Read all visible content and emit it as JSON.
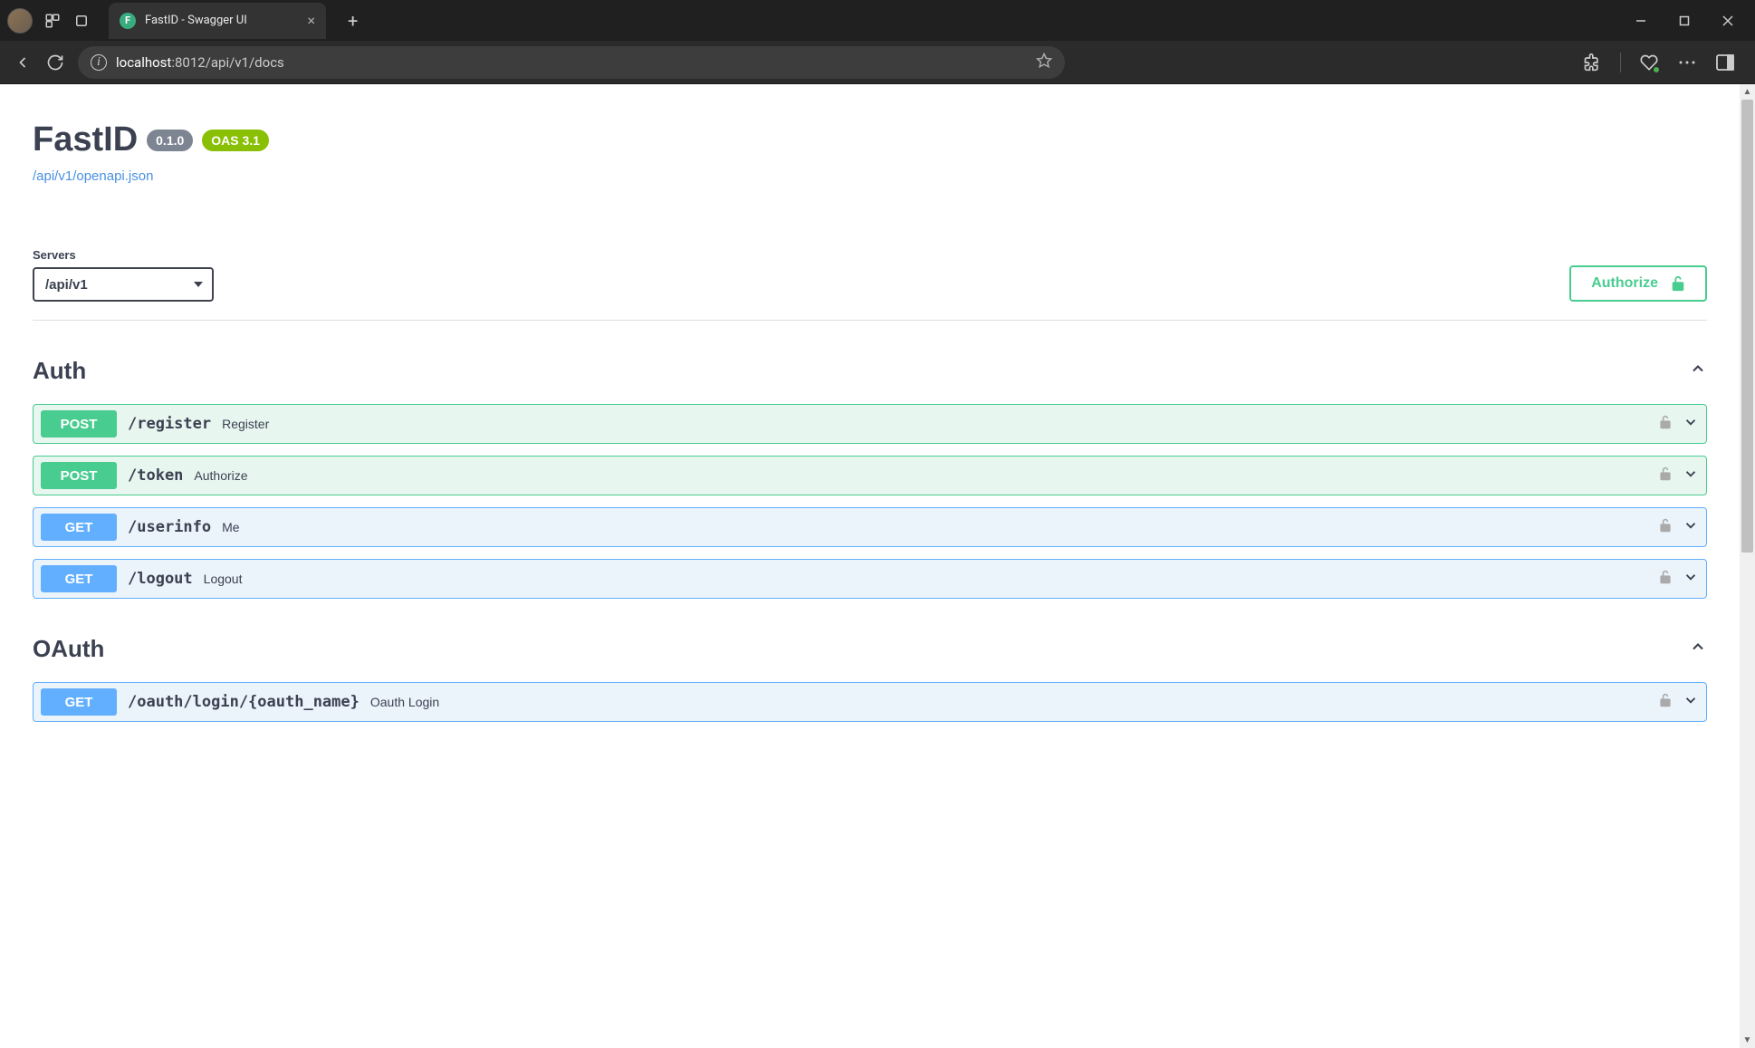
{
  "browser": {
    "tab_title": "FastID - Swagger UI",
    "url_host": "localhost",
    "url_port": ":8012",
    "url_path": "/api/v1/docs"
  },
  "api": {
    "title": "FastID",
    "version": "0.1.0",
    "oas": "OAS 3.1",
    "spec_link": "/api/v1/openapi.json"
  },
  "servers": {
    "label": "Servers",
    "selected": "/api/v1"
  },
  "authorize_label": "Authorize",
  "tags": [
    {
      "name": "Auth",
      "endpoints": [
        {
          "method": "POST",
          "path": "/register",
          "summary": "Register"
        },
        {
          "method": "POST",
          "path": "/token",
          "summary": "Authorize"
        },
        {
          "method": "GET",
          "path": "/userinfo",
          "summary": "Me"
        },
        {
          "method": "GET",
          "path": "/logout",
          "summary": "Logout"
        }
      ]
    },
    {
      "name": "OAuth",
      "endpoints": [
        {
          "method": "GET",
          "path": "/oauth/login/{oauth_name}",
          "summary": "Oauth Login"
        }
      ]
    }
  ]
}
